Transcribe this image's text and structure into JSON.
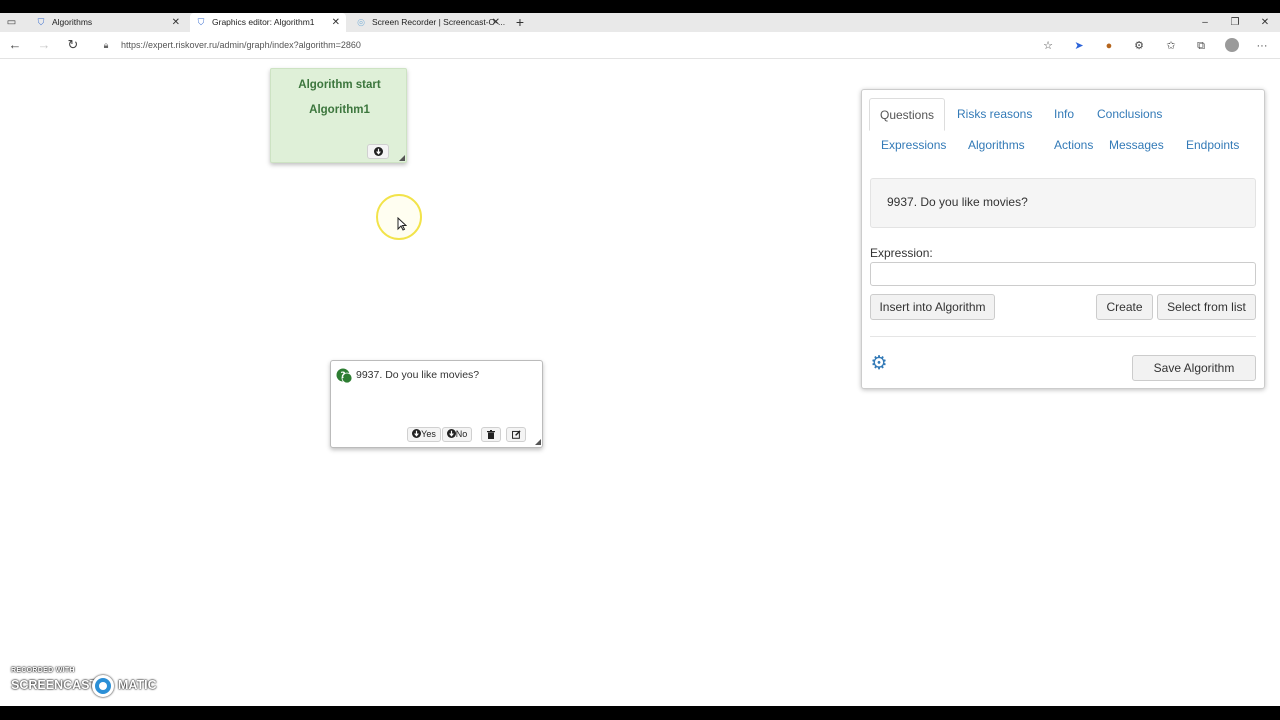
{
  "browser": {
    "tab_actions_icon": "tab-actions-icon",
    "tabs": [
      {
        "title": "Algorithms",
        "close": "✕"
      },
      {
        "title": "Graphics editor: Algorithm1",
        "close": "✕"
      },
      {
        "title": "Screen Recorder | Screencast-O-...",
        "close": "✕"
      }
    ],
    "new_tab": "+",
    "window_controls": {
      "minimize": "–",
      "restore": "❐",
      "close": "✕"
    },
    "nav": {
      "back": "←",
      "forward": "→",
      "reload": "↻"
    },
    "url": "https://expert.riskover.ru/admin/graph/index?algorithm=2860",
    "more": "···"
  },
  "editor": {
    "start_node": {
      "title": "Algorithm start",
      "name": "Algorithm1"
    },
    "question_node": {
      "text": "9937. Do you like movies?",
      "yes_label": "Yes",
      "no_label": "No"
    }
  },
  "panel": {
    "tabs_row1": [
      "Questions",
      "Risks reasons",
      "Info",
      "Conclusions"
    ],
    "tabs_row2": [
      "Expressions",
      "Algorithms",
      "Actions",
      "Messages",
      "Endpoints"
    ],
    "active_tab": "Questions",
    "selected_question": "9937. Do you like movies?",
    "expression_label": "Expression:",
    "expression_value": "",
    "insert_button": "Insert into Algorithm",
    "create_button": "Create",
    "select_button": "Select from list",
    "save_button": "Save Algorithm"
  },
  "watermark": {
    "line1": "RECORDED WITH",
    "left": "SCREENCAST",
    "right": "MATIC"
  },
  "colors": {
    "link": "#337ab7",
    "start_node_bg": "#dff0d8",
    "start_node_text": "#3c763d",
    "question_icon": "#2d7d32"
  }
}
